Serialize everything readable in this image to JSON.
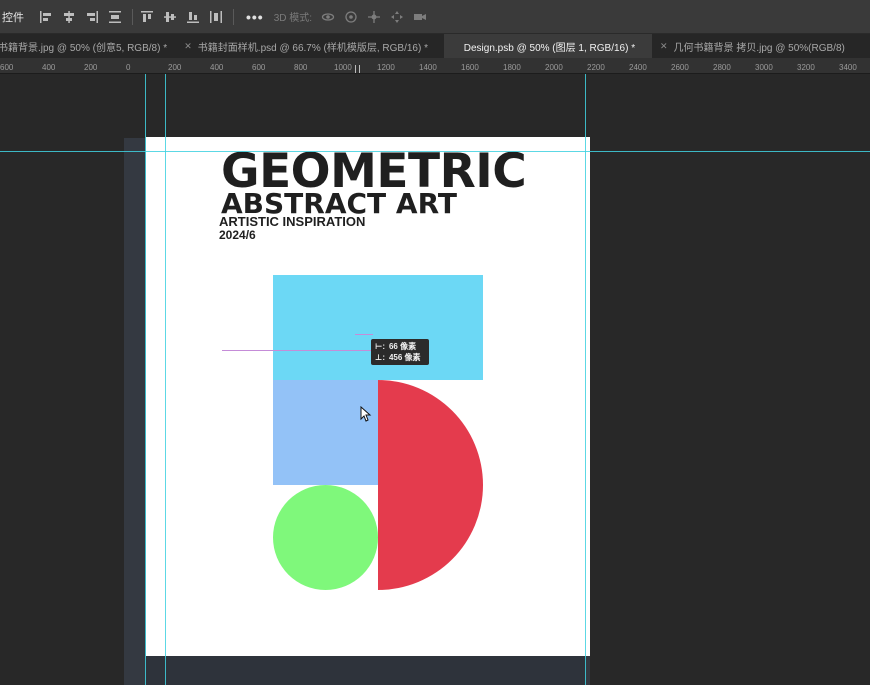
{
  "toolbar": {
    "label": "控件",
    "more": "•••",
    "mode_3d": "3D 模式:",
    "align_icons": [
      "align-left-icon",
      "align-hcenter-icon",
      "align-right-icon",
      "distribute-h-icon",
      "align-top-icon",
      "align-vcenter-icon",
      "align-bottom-icon",
      "distribute-v-icon"
    ],
    "mode_icons": [
      "orbit-3d-icon",
      "roll-3d-icon",
      "pan-3d-icon",
      "slide-3d-icon",
      "camera-3d-icon"
    ]
  },
  "tabs": [
    {
      "label": "书籍背景.jpg @ 50% (创意5, RGB/8) *",
      "active": false
    },
    {
      "label": "书籍封面样机.psd @ 66.7% (样机模版层, RGB/16) *",
      "active": false
    },
    {
      "label": "Design.psb @ 50% (图层 1, RGB/16) *",
      "active": true
    },
    {
      "label": "几何书籍背景 拷贝.jpg @ 50%(RGB/8)",
      "active": false
    }
  ],
  "ruler": {
    "labels": [
      "600",
      "400",
      "200",
      "0",
      "200",
      "400",
      "600",
      "800",
      "1000",
      "1200",
      "1400",
      "1600",
      "1800",
      "2000",
      "2200",
      "2400",
      "2600",
      "2800",
      "3000",
      "3200",
      "3400"
    ]
  },
  "document": {
    "title_line1": "GEOMETRIC",
    "title_line2": "ABSTRACT ART",
    "title_line3": "ARTISTIC INSPIRATION",
    "title_line4": "2024/6",
    "colors": {
      "cyan": "#6cd8f5",
      "blue": "#93c2f7",
      "green": "#7ff87b",
      "red": "#e43b4d",
      "text": "#1f1f1f"
    }
  },
  "measure": {
    "row1_icon": "⊢:",
    "row1_value": "66 像素",
    "row2_icon": "⊥:",
    "row2_value": "456 像素"
  }
}
